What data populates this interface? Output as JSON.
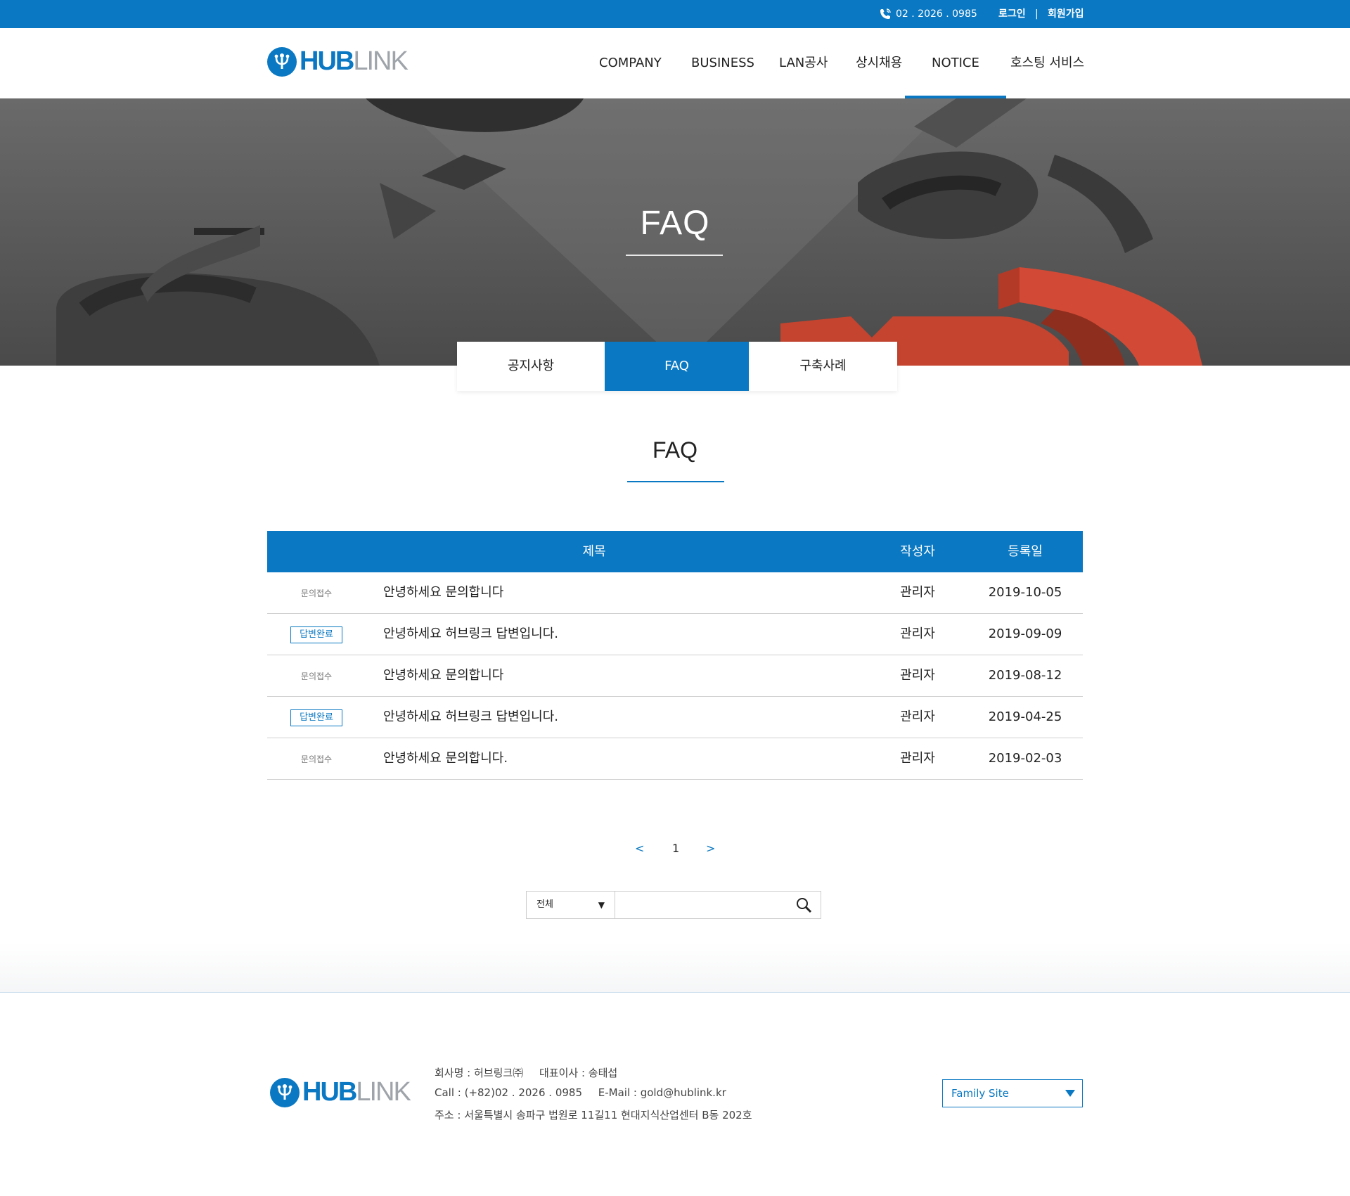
{
  "topbar": {
    "phone": "02 . 2026 . 0985",
    "login": "로그인",
    "separator": "|",
    "join": "회원가입"
  },
  "header": {
    "logo_hub": "HUB",
    "logo_link": "LINK",
    "nav": [
      {
        "label": "COMPANY"
      },
      {
        "label": "BUSINESS"
      },
      {
        "label": "LAN공사"
      },
      {
        "label": "상시채용"
      },
      {
        "label": "NOTICE",
        "active": true
      },
      {
        "label": "호스팅 서비스"
      }
    ]
  },
  "hero": {
    "title": "FAQ"
  },
  "subtabs": [
    {
      "label": "공지사항"
    },
    {
      "label": "FAQ",
      "active": true
    },
    {
      "label": "구축사례"
    }
  ],
  "section": {
    "title": "FAQ"
  },
  "table": {
    "headers": {
      "title": "제목",
      "author": "작성자",
      "date": "등록일"
    },
    "rows": [
      {
        "status": "문의접수",
        "status_type": "pending",
        "title": "안녕하세요 문의합니다",
        "author": "관리자",
        "date": "2019-10-05"
      },
      {
        "status": "답변완료",
        "status_type": "done",
        "title": "안녕하세요 허브링크 답변입니다.",
        "author": "관리자",
        "date": "2019-09-09"
      },
      {
        "status": "문의접수",
        "status_type": "pending",
        "title": "안녕하세요 문의합니다",
        "author": "관리자",
        "date": "2019-08-12"
      },
      {
        "status": "답변완료",
        "status_type": "done",
        "title": "안녕하세요 허브링크 답변입니다.",
        "author": "관리자",
        "date": "2019-04-25"
      },
      {
        "status": "문의접수",
        "status_type": "pending",
        "title": "안녕하세요 문의합니다.",
        "author": "관리자",
        "date": "2019-02-03"
      }
    ]
  },
  "pagination": {
    "prev": "<",
    "current": "1",
    "next": ">"
  },
  "search": {
    "scope": "전체",
    "caret": "▼",
    "query": "",
    "icon": "search-icon"
  },
  "footer": {
    "logo_hub": "HUB",
    "logo_link": "LINK",
    "company_label": "회사명 : 허브링크㈜",
    "ceo_label": "대표이사 : 송태섭",
    "call_label": "Call :  (+82)02 . 2026 . 0985",
    "email_label": "E-Mail : gold@hublink.kr",
    "address_label": "주소 : 서울특별시 송파구 법원로 11길11 현대지식산업센터 B동 202호",
    "family_site": "Family Site"
  },
  "colors": {
    "brand_blue": "#0a78c2",
    "hero_accent_red": "#d24a35"
  }
}
